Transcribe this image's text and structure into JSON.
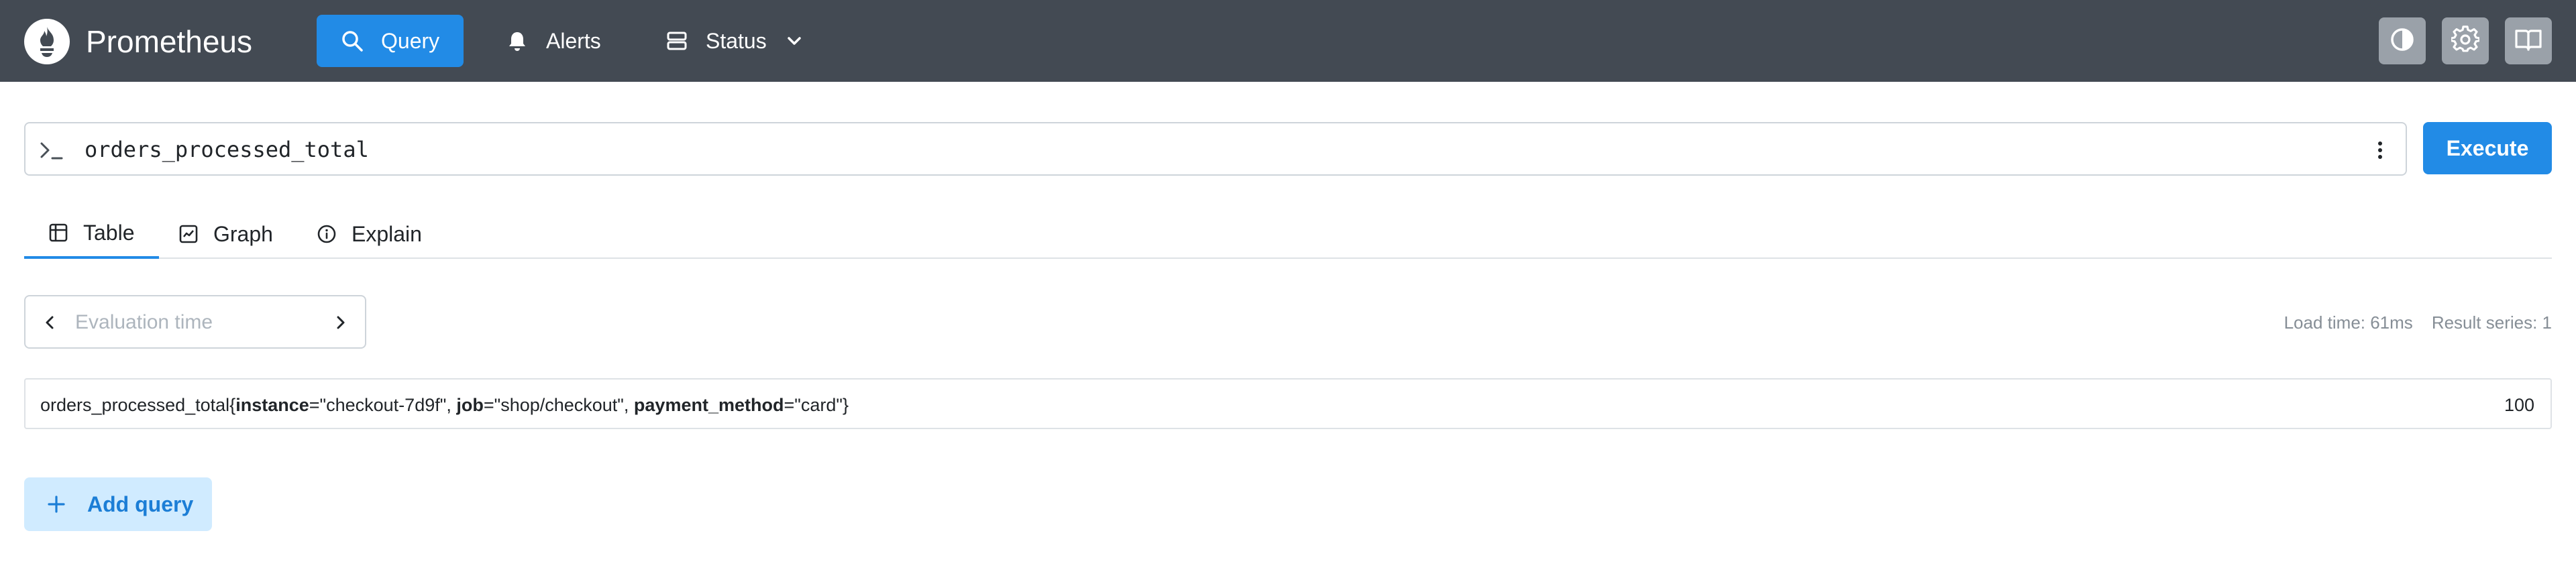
{
  "header": {
    "brand": "Prometheus",
    "nav": {
      "query": "Query",
      "alerts": "Alerts",
      "status": "Status"
    }
  },
  "query": {
    "expression": "orders_processed_total",
    "execute_label": "Execute"
  },
  "tabs": {
    "table": "Table",
    "graph": "Graph",
    "explain": "Explain"
  },
  "eval": {
    "placeholder": "Evaluation time"
  },
  "stats": {
    "load_time": "Load time: 61ms",
    "result_series": "Result series: 1"
  },
  "result": {
    "metric": "orders_processed_total",
    "open": "{",
    "labels": [
      {
        "name": "instance",
        "value": "\"checkout-7d9f\""
      },
      {
        "name": "job",
        "value": "\"shop/checkout\""
      },
      {
        "name": "payment_method",
        "value": "\"card\""
      }
    ],
    "eq": "=",
    "sep": ", ",
    "close": "}",
    "value": "100"
  },
  "add_query": {
    "label": "Add query"
  },
  "colors": {
    "header_bg": "#434a53",
    "accent": "#228be6",
    "add_query_bg": "#d0ebff"
  },
  "icons": {
    "logo": "prometheus-flame-icon",
    "query": "search-icon",
    "alerts": "bell-icon",
    "status": "server-icon",
    "theme": "contrast-icon",
    "settings": "gear-icon",
    "docs": "book-icon"
  }
}
